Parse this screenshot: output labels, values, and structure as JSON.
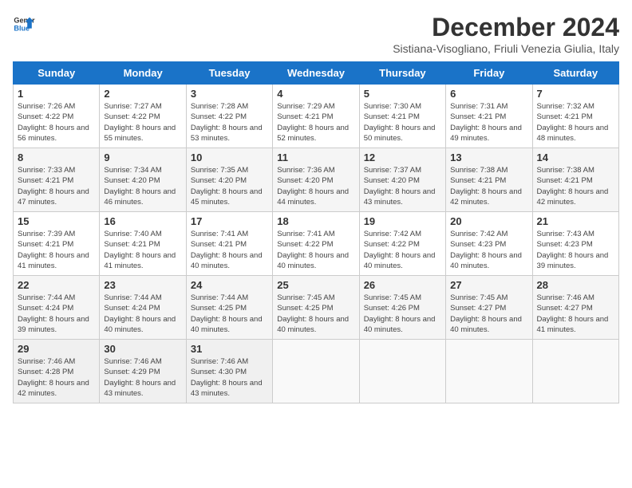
{
  "logo": {
    "line1": "General",
    "line2": "Blue"
  },
  "title": "December 2024",
  "location": "Sistiana-Visogliano, Friuli Venezia Giulia, Italy",
  "weekdays": [
    "Sunday",
    "Monday",
    "Tuesday",
    "Wednesday",
    "Thursday",
    "Friday",
    "Saturday"
  ],
  "weeks": [
    [
      {
        "day": "1",
        "sunrise": "7:26 AM",
        "sunset": "4:22 PM",
        "daylight": "8 hours and 56 minutes."
      },
      {
        "day": "2",
        "sunrise": "7:27 AM",
        "sunset": "4:22 PM",
        "daylight": "8 hours and 55 minutes."
      },
      {
        "day": "3",
        "sunrise": "7:28 AM",
        "sunset": "4:22 PM",
        "daylight": "8 hours and 53 minutes."
      },
      {
        "day": "4",
        "sunrise": "7:29 AM",
        "sunset": "4:21 PM",
        "daylight": "8 hours and 52 minutes."
      },
      {
        "day": "5",
        "sunrise": "7:30 AM",
        "sunset": "4:21 PM",
        "daylight": "8 hours and 50 minutes."
      },
      {
        "day": "6",
        "sunrise": "7:31 AM",
        "sunset": "4:21 PM",
        "daylight": "8 hours and 49 minutes."
      },
      {
        "day": "7",
        "sunrise": "7:32 AM",
        "sunset": "4:21 PM",
        "daylight": "8 hours and 48 minutes."
      }
    ],
    [
      {
        "day": "8",
        "sunrise": "7:33 AM",
        "sunset": "4:21 PM",
        "daylight": "8 hours and 47 minutes."
      },
      {
        "day": "9",
        "sunrise": "7:34 AM",
        "sunset": "4:20 PM",
        "daylight": "8 hours and 46 minutes."
      },
      {
        "day": "10",
        "sunrise": "7:35 AM",
        "sunset": "4:20 PM",
        "daylight": "8 hours and 45 minutes."
      },
      {
        "day": "11",
        "sunrise": "7:36 AM",
        "sunset": "4:20 PM",
        "daylight": "8 hours and 44 minutes."
      },
      {
        "day": "12",
        "sunrise": "7:37 AM",
        "sunset": "4:20 PM",
        "daylight": "8 hours and 43 minutes."
      },
      {
        "day": "13",
        "sunrise": "7:38 AM",
        "sunset": "4:21 PM",
        "daylight": "8 hours and 42 minutes."
      },
      {
        "day": "14",
        "sunrise": "7:38 AM",
        "sunset": "4:21 PM",
        "daylight": "8 hours and 42 minutes."
      }
    ],
    [
      {
        "day": "15",
        "sunrise": "7:39 AM",
        "sunset": "4:21 PM",
        "daylight": "8 hours and 41 minutes."
      },
      {
        "day": "16",
        "sunrise": "7:40 AM",
        "sunset": "4:21 PM",
        "daylight": "8 hours and 41 minutes."
      },
      {
        "day": "17",
        "sunrise": "7:41 AM",
        "sunset": "4:21 PM",
        "daylight": "8 hours and 40 minutes."
      },
      {
        "day": "18",
        "sunrise": "7:41 AM",
        "sunset": "4:22 PM",
        "daylight": "8 hours and 40 minutes."
      },
      {
        "day": "19",
        "sunrise": "7:42 AM",
        "sunset": "4:22 PM",
        "daylight": "8 hours and 40 minutes."
      },
      {
        "day": "20",
        "sunrise": "7:42 AM",
        "sunset": "4:23 PM",
        "daylight": "8 hours and 40 minutes."
      },
      {
        "day": "21",
        "sunrise": "7:43 AM",
        "sunset": "4:23 PM",
        "daylight": "8 hours and 39 minutes."
      }
    ],
    [
      {
        "day": "22",
        "sunrise": "7:44 AM",
        "sunset": "4:24 PM",
        "daylight": "8 hours and 39 minutes."
      },
      {
        "day": "23",
        "sunrise": "7:44 AM",
        "sunset": "4:24 PM",
        "daylight": "8 hours and 40 minutes."
      },
      {
        "day": "24",
        "sunrise": "7:44 AM",
        "sunset": "4:25 PM",
        "daylight": "8 hours and 40 minutes."
      },
      {
        "day": "25",
        "sunrise": "7:45 AM",
        "sunset": "4:25 PM",
        "daylight": "8 hours and 40 minutes."
      },
      {
        "day": "26",
        "sunrise": "7:45 AM",
        "sunset": "4:26 PM",
        "daylight": "8 hours and 40 minutes."
      },
      {
        "day": "27",
        "sunrise": "7:45 AM",
        "sunset": "4:27 PM",
        "daylight": "8 hours and 40 minutes."
      },
      {
        "day": "28",
        "sunrise": "7:46 AM",
        "sunset": "4:27 PM",
        "daylight": "8 hours and 41 minutes."
      }
    ],
    [
      {
        "day": "29",
        "sunrise": "7:46 AM",
        "sunset": "4:28 PM",
        "daylight": "8 hours and 42 minutes."
      },
      {
        "day": "30",
        "sunrise": "7:46 AM",
        "sunset": "4:29 PM",
        "daylight": "8 hours and 43 minutes."
      },
      {
        "day": "31",
        "sunrise": "7:46 AM",
        "sunset": "4:30 PM",
        "daylight": "8 hours and 43 minutes."
      },
      null,
      null,
      null,
      null
    ]
  ],
  "labels": {
    "sunrise": "Sunrise:",
    "sunset": "Sunset:",
    "daylight": "Daylight:"
  }
}
